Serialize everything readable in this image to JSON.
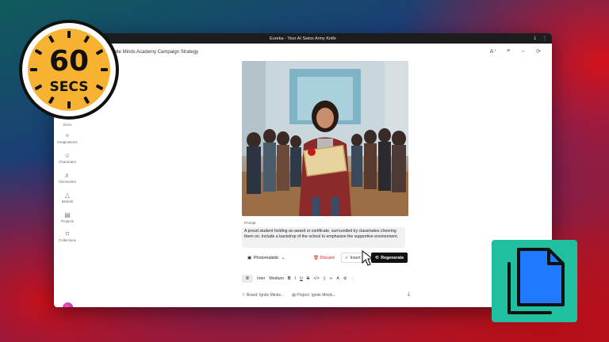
{
  "window": {
    "title": "Eureka - Your AI Swiss Army Knife",
    "doc_title": "gnite Minds Academy Campaign Strategy"
  },
  "sidebar": {
    "items": [
      {
        "label": "Docs",
        "icon": "docs-icon"
      },
      {
        "label": "Imaginations",
        "icon": "sparkle-icon"
      },
      {
        "label": "Characters",
        "icon": "characters-icon"
      },
      {
        "label": "Voiceovers",
        "icon": "voiceover-icon"
      },
      {
        "label": "Brands",
        "icon": "brand-icon"
      },
      {
        "label": "Projects",
        "icon": "projects-icon"
      },
      {
        "label": "Collections",
        "icon": "bookmark-icon"
      }
    ]
  },
  "image_card": {
    "prompt_label": "Prompt",
    "prompt_text": "A proud student holding an award or certificate, surrounded by classmates cheering them on. Include a backdrop of the school to emphasize the supportive environment.",
    "style_label": "Photorealistic",
    "discard_label": "Discard",
    "insert_label": "Insert",
    "regenerate_label": "Regenerate"
  },
  "editor_toolbar": {
    "font": "Inter",
    "size": "Medium",
    "buttons": [
      "B",
      "I",
      "U",
      "S",
      "</>"
    ]
  },
  "footer": {
    "brand": "Brand: Ignite Minds...",
    "project": "Project: Ignite Minds..."
  },
  "overlay": {
    "timer_value": "60",
    "timer_unit": "SECS"
  },
  "colors": {
    "timer_face": "#f7b231",
    "copy_badge": "#1fbf9f",
    "copy_icon": "#1e7bff",
    "discard": "#dd2222"
  }
}
